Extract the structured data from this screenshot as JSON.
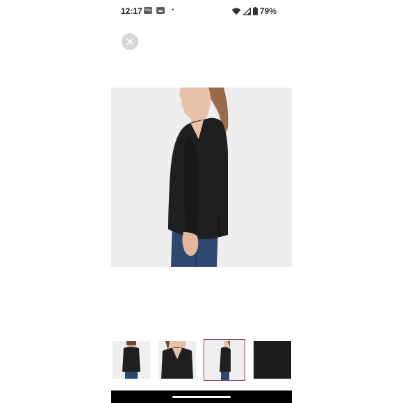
{
  "status_bar": {
    "time": "12:17",
    "etsy_label": "Etsy",
    "dot": "•",
    "battery": "79%"
  },
  "icons": {
    "close": "close-icon",
    "wifi": "wifi-icon",
    "signal": "signal-icon",
    "battery": "battery-icon"
  },
  "gallery": {
    "thumbnail_count": 4,
    "selected_index": 2
  },
  "colors": {
    "sweater": "#1f1f21",
    "jeans": "#2f4770",
    "skin": "#e8c2a8",
    "hair": "#9a6a4c",
    "background": "#efeeee",
    "selected_border": "#6a3a6a"
  }
}
